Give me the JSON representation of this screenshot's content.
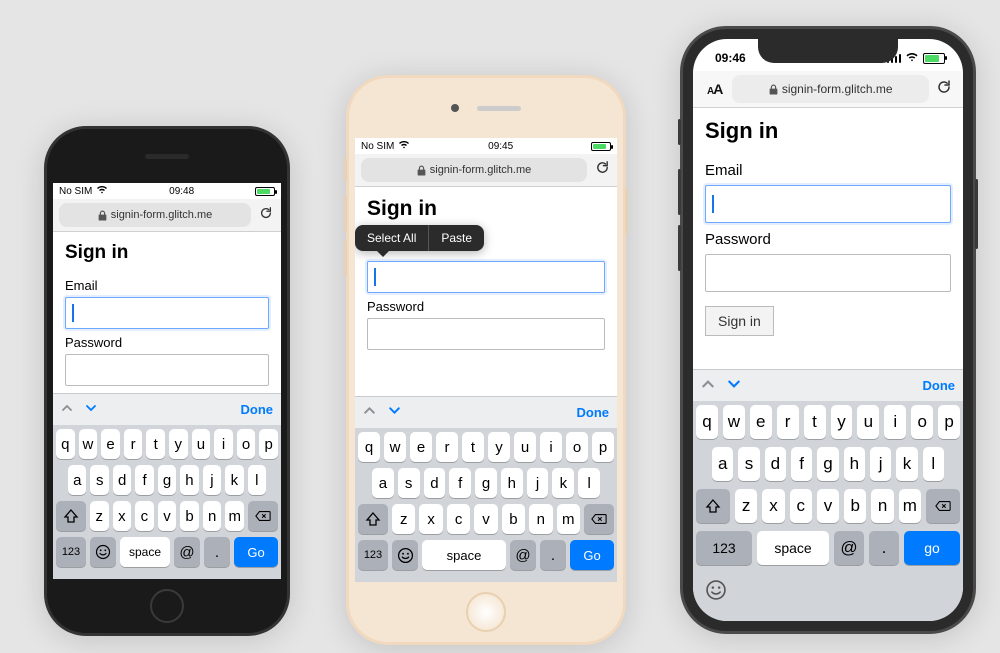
{
  "page": {
    "heading": "Sign in",
    "email_label": "Email",
    "password_label": "Password",
    "signin_button": "Sign in"
  },
  "address": {
    "url": "signin-form.glitch.me",
    "aa": "AA"
  },
  "phone1": {
    "carrier": "No SIM",
    "time": "09:48"
  },
  "phone2": {
    "carrier": "No SIM",
    "time": "09:45"
  },
  "phone3": {
    "time": "09:46"
  },
  "context_menu": {
    "select_all": "Select All",
    "paste": "Paste"
  },
  "keyboard": {
    "done": "Done",
    "row1": [
      "q",
      "w",
      "e",
      "r",
      "t",
      "y",
      "u",
      "i",
      "o",
      "p"
    ],
    "row2": [
      "a",
      "s",
      "d",
      "f",
      "g",
      "h",
      "j",
      "k",
      "l"
    ],
    "row3": [
      "z",
      "x",
      "c",
      "v",
      "b",
      "n",
      "m"
    ],
    "num": "123",
    "space": "space",
    "at": "@",
    "dot": ".",
    "go_cap": "Go",
    "go_low": "go"
  }
}
